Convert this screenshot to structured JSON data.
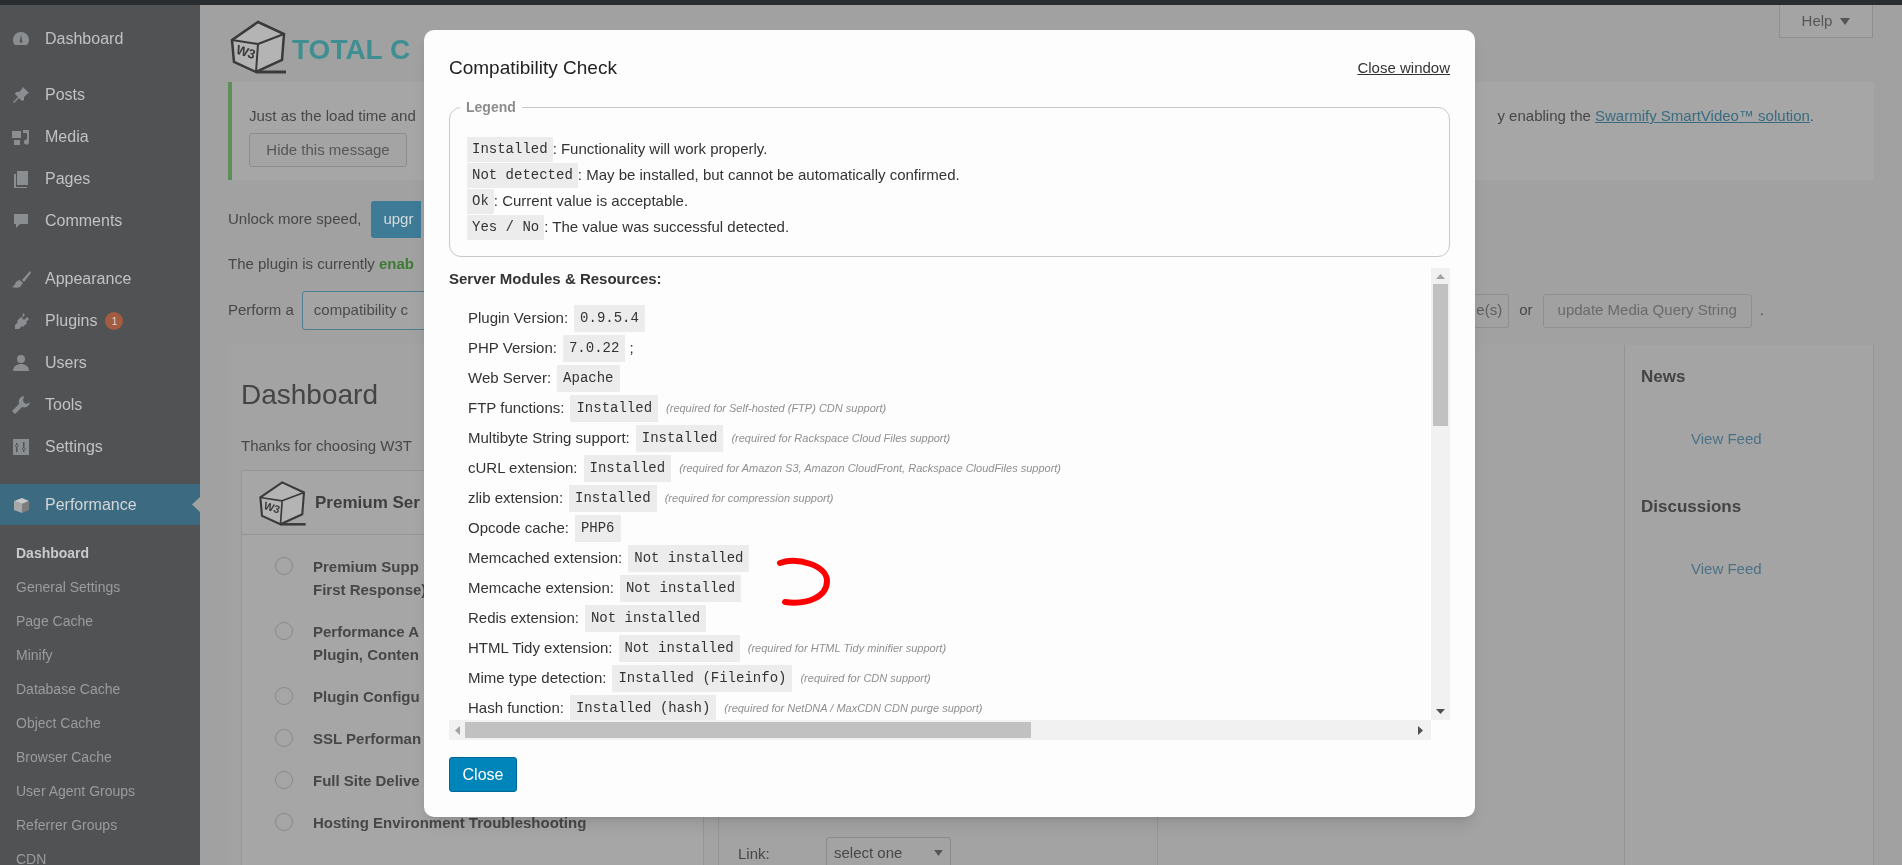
{
  "admin_menu": {
    "groups": [
      {
        "items": [
          {
            "label": "Dashboard",
            "selected": false
          }
        ]
      },
      {
        "items": [
          {
            "label": "Posts",
            "selected": false
          },
          {
            "label": "Media",
            "selected": false
          },
          {
            "label": "Pages",
            "selected": false
          },
          {
            "label": "Comments",
            "selected": false
          }
        ]
      },
      {
        "items": [
          {
            "label": "Appearance",
            "selected": false
          },
          {
            "label": "Plugins",
            "badge": "1",
            "selected": false
          },
          {
            "label": "Users",
            "selected": false
          },
          {
            "label": "Tools",
            "selected": false
          },
          {
            "label": "Settings",
            "selected": false
          }
        ]
      },
      {
        "items": [
          {
            "label": "Performance",
            "selected": true,
            "submenu": [
              {
                "label": "Dashboard",
                "selected": true
              },
              {
                "label": "General Settings",
                "selected": false
              },
              {
                "label": "Page Cache",
                "selected": false
              },
              {
                "label": "Minify",
                "selected": false
              },
              {
                "label": "Database Cache",
                "selected": false
              },
              {
                "label": "Object Cache",
                "selected": false
              },
              {
                "label": "Browser Cache",
                "selected": false
              },
              {
                "label": "User Agent Groups",
                "selected": false
              },
              {
                "label": "Referrer Groups",
                "selected": false
              },
              {
                "label": "CDN",
                "selected": false
              }
            ]
          }
        ]
      }
    ]
  },
  "header": {
    "logo_badge": "W3",
    "logo_text": "TOTAL C",
    "help": "Help"
  },
  "notice": {
    "text_start": "Just as the load time and",
    "text_end": "y enabling the",
    "link": "Swarmify SmartVideo™ solution",
    "end": ".",
    "button": "Hide this message"
  },
  "upgrade_line": {
    "text": "Unlock more speed,",
    "button": "upgr"
  },
  "status_line": "The plugin is currently **enab**",
  "actions_line": {
    "prefix": "Perform a",
    "field_button": "compatibility c",
    "cut_button": "e(s)",
    "or": "or",
    "button": "update Media Query String",
    "end": "."
  },
  "dashboard": {
    "title": "Dashboard",
    "intro": "Thanks for choosing W3T",
    "premium": {
      "badge": "W3",
      "title": "Premium Ser",
      "options": [
        {
          "lines": [
            "Premium Supp",
            "First Response)"
          ],
          "selected": false
        },
        {
          "lines": [
            "Performance A",
            "Plugin, Conten"
          ],
          "selected": false
        },
        {
          "lines": [
            "Plugin Configu"
          ],
          "selected": false
        },
        {
          "lines": [
            "SSL Performan"
          ],
          "selected": false
        },
        {
          "lines": [
            "Full Site Delive"
          ],
          "selected": false
        },
        {
          "lines": [
            "Hosting Environment Troubleshooting"
          ],
          "selected": false
        }
      ]
    },
    "link_label": "Link:",
    "link_select": "select one"
  },
  "widgets": [
    {
      "title": "News",
      "link": "View Feed"
    },
    {
      "title": "Discussions",
      "link": "View Feed"
    }
  ],
  "modal": {
    "title": "Compatibility Check",
    "close_link": "Close window",
    "legend": {
      "title": "Legend",
      "entries": [
        {
          "term": "Installed",
          "text": ": Functionality will work properly."
        },
        {
          "term": "Not detected",
          "text": ": May be installed, but cannot be automatically confirmed."
        },
        {
          "term": "Ok",
          "text": ": Current value is acceptable."
        },
        {
          "term": "Yes / No",
          "text": ": The value was successful detected."
        }
      ]
    },
    "section_title": "Server Modules & Resources:",
    "rows": [
      {
        "label": "Plugin Version:",
        "value": "0.9.5.4"
      },
      {
        "label": "PHP Version:",
        "value": "7.0.22",
        "suffix": ";"
      },
      {
        "label": "Web Server:",
        "value": "Apache"
      },
      {
        "label": "FTP functions:",
        "value": "Installed",
        "note": "(required for Self-hosted (FTP) CDN support)"
      },
      {
        "label": "Multibyte String support:",
        "value": "Installed",
        "note": "(required for Rackspace Cloud Files support)"
      },
      {
        "label": "cURL extension:",
        "value": "Installed",
        "note": "(required for Amazon S3, Amazon CloudFront, Rackspace CloudFiles support)"
      },
      {
        "label": "zlib extension:",
        "value": "Installed",
        "note": "(required for compression support)"
      },
      {
        "label": "Opcode cache:",
        "value": "PHP6"
      },
      {
        "label": "Memcached extension:",
        "value": "Not installed"
      },
      {
        "label": "Memcache extension:",
        "value": "Not installed"
      },
      {
        "label": "Redis extension:",
        "value": "Not installed"
      },
      {
        "label": "HTML Tidy extension:",
        "value": "Not installed",
        "note": "(required for HTML Tidy minifier support)"
      },
      {
        "label": "Mime type detection:",
        "value": "Installed (Fileinfo)",
        "note": "(required for CDN support)"
      },
      {
        "label": "Hash function:",
        "value": "Installed (hash)",
        "note": "(required for NetDNA / MaxCDN CDN purge support)"
      }
    ],
    "close_button": "Close"
  }
}
